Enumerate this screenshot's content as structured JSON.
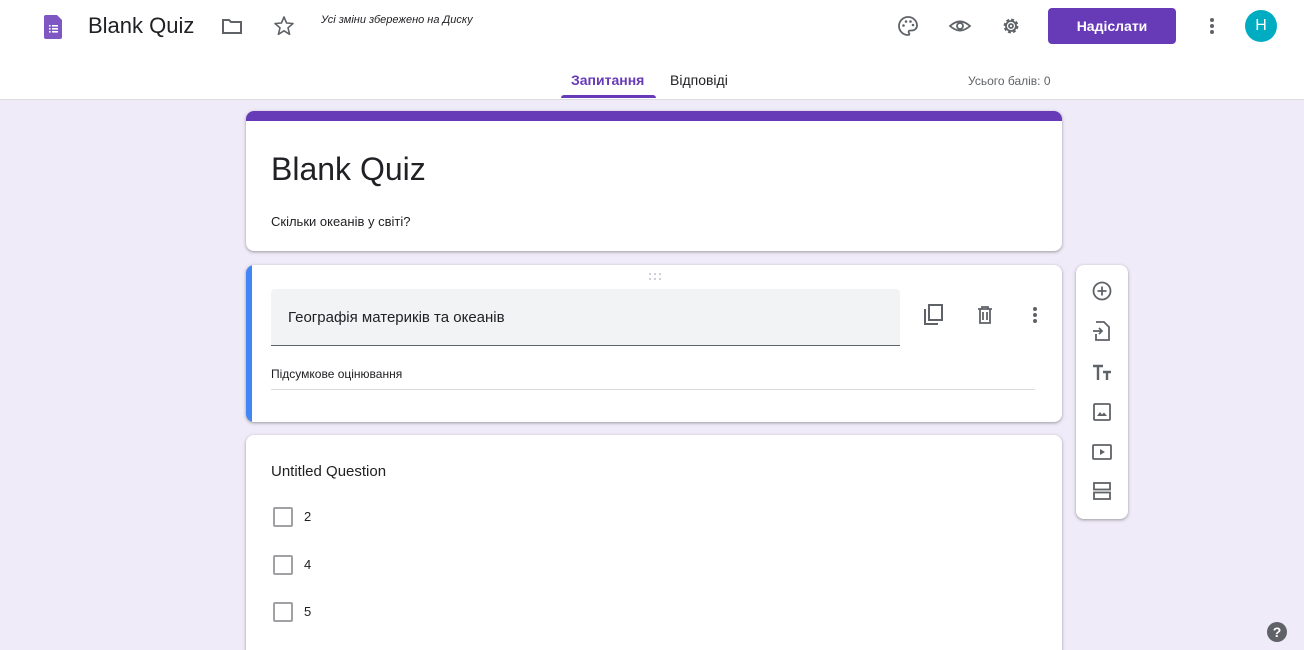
{
  "header": {
    "title": "Blank Quiz",
    "save_status": "Усі зміни збережено на Диску",
    "send_label": "Надіслати",
    "avatar_letter": "Н",
    "icons": [
      "forms-icon",
      "folder-icon",
      "star-icon",
      "palette-icon",
      "preview-eye-icon",
      "settings-gear-icon",
      "more-vert-icon"
    ]
  },
  "tabs": [
    {
      "label": "Запитання",
      "active": true
    },
    {
      "label": "Відповіді",
      "active": false
    }
  ],
  "total_points": "Усього балів: 0",
  "form": {
    "title": "Blank Quiz",
    "description": "Скільки океанів у світі?"
  },
  "section": {
    "title": "Географія материків та океанів",
    "description": "Підсумкове оцінювання"
  },
  "question": {
    "title": "Untitled Question",
    "options": [
      "2",
      "4",
      "5"
    ]
  },
  "toolbar": [
    "add-question-icon",
    "import-questions-icon",
    "add-title-icon",
    "add-image-icon",
    "add-video-icon",
    "add-section-icon"
  ],
  "colors": {
    "accent": "#673ab7",
    "background": "#f0ebf8",
    "section_stripe": "#4285f4",
    "avatar": "#00acc1"
  }
}
